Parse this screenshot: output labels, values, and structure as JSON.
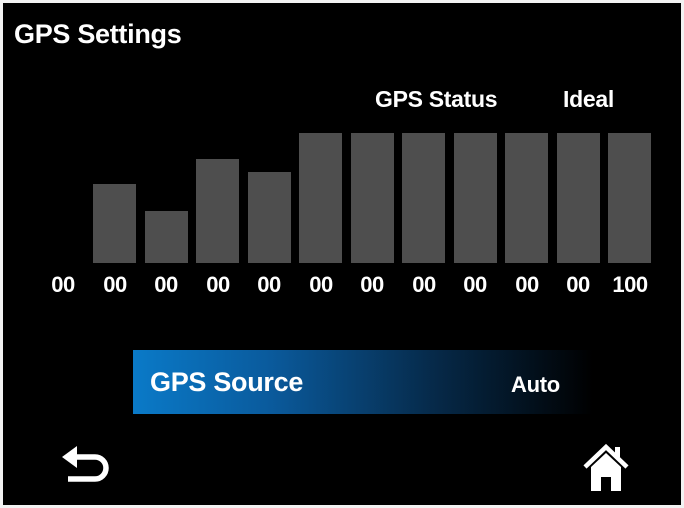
{
  "header": {
    "title": "GPS Settings"
  },
  "status": {
    "label": "GPS Status",
    "value": "Ideal"
  },
  "chart_data": {
    "type": "bar",
    "values_shown": [
      "00",
      "00",
      "00",
      "00",
      "00",
      "00",
      "00",
      "00",
      "00",
      "00",
      "00",
      "100"
    ],
    "bar_levels": [
      null,
      0.61,
      0.4,
      0.8,
      0.7,
      1.0,
      1.0,
      1.0,
      1.0,
      1.0,
      1.0,
      1.0
    ],
    "bar_color": "#4e4e4e"
  },
  "source": {
    "label": "GPS Source",
    "value": "Auto",
    "accent_color": "#0a7ac8"
  },
  "footer": {
    "back_icon": "back-arrow-icon",
    "home_icon": "home-icon"
  }
}
